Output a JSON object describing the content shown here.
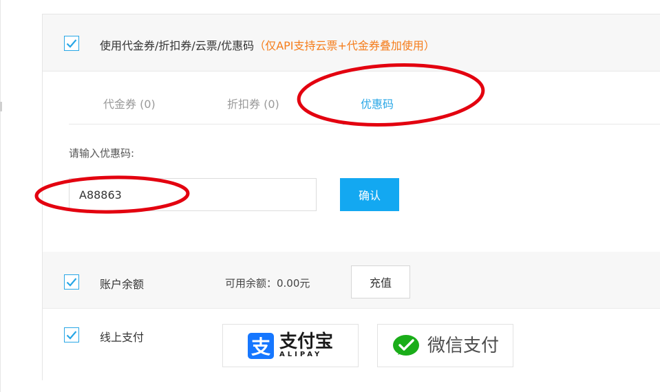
{
  "coupon_section": {
    "checkbox_checked": true,
    "label": "使用代金券/折扣券/云票/优惠码",
    "note": "（仅API支持云票+代金券叠加使用）",
    "tabs": [
      {
        "label": "代金券 (0)",
        "active": false
      },
      {
        "label": "折扣券 (0)",
        "active": false
      },
      {
        "label": "优惠码",
        "active": true
      }
    ],
    "prompt": "请输入优惠码:",
    "code_value": "A88863",
    "confirm_label": "确认"
  },
  "balance_section": {
    "checkbox_checked": true,
    "label": "账户余额",
    "available_text": "可用余额：0.00元",
    "recharge_label": "充值"
  },
  "online_section": {
    "checkbox_checked": true,
    "label": "线上支付",
    "alipay": {
      "text": "支付宝",
      "sub": "ALIPAY",
      "icon_char": "支"
    },
    "wechat": {
      "text": "微信支付"
    }
  },
  "colors": {
    "accent": "#27a6e6",
    "button_blue": "#13a8f1",
    "note_orange": "#f57c1a",
    "annotation_red": "#e3000f",
    "alipay_blue": "#1677ff",
    "wechat_green": "#1aad19"
  }
}
